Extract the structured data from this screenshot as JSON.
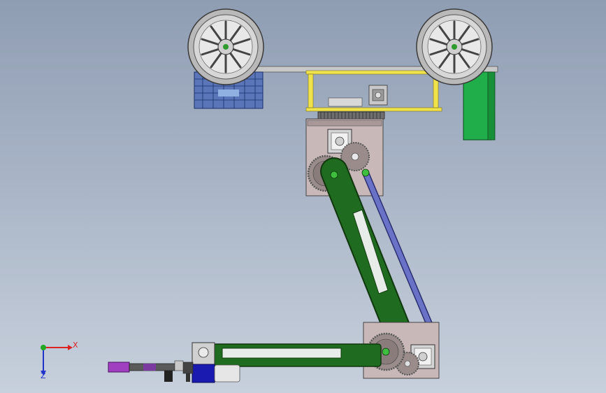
{
  "triad": {
    "x_label": "X",
    "z_label": "Z"
  },
  "colors": {
    "background_top": "#8f9db3",
    "background_bottom": "#c7d0dc",
    "wheel_gray": "#c8c8c8",
    "arm_green": "#1f6b1f",
    "link_blue": "#6a72c8",
    "plate_pink": "#c9b8b8",
    "gear_gray": "#9a8c8a",
    "column_yellow": "#f0e24a",
    "battery_green": "#1fae4a",
    "basket_blue": "#3a5fb0",
    "motor_blue": "#1a1ab0",
    "gripper_purple": "#a040c0",
    "axis_x": "#dd2222",
    "axis_y": "#22aa22",
    "axis_z": "#2233cc"
  }
}
